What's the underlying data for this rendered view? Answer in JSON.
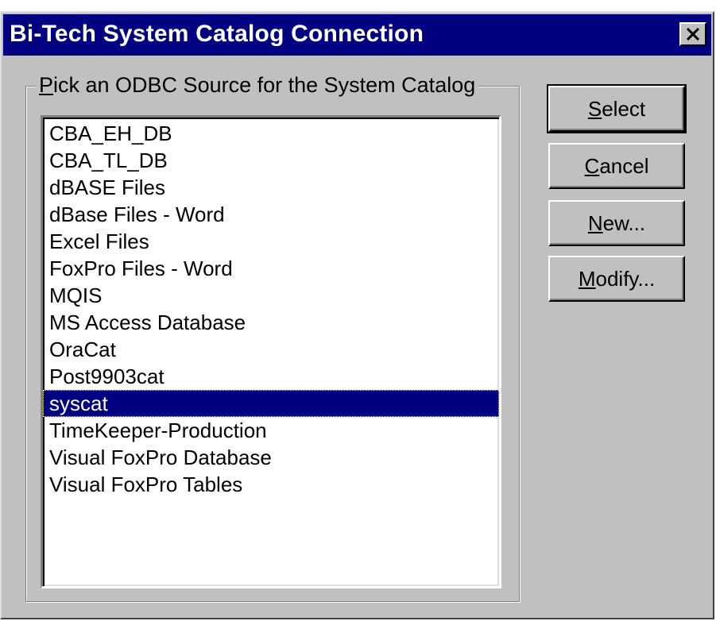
{
  "window": {
    "title": "Bi-Tech System Catalog Connection",
    "close_glyph": "✕"
  },
  "group": {
    "label_accel": "P",
    "label_rest": "ick an ODBC Source for the System Catalog"
  },
  "list": {
    "items": [
      "CBA_EH_DB",
      "CBA_TL_DB",
      "dBASE Files",
      "dBase Files - Word",
      "Excel Files",
      "FoxPro Files - Word",
      "MQIS",
      "MS Access Database",
      "OraCat",
      "Post9903cat",
      "syscat",
      "TimeKeeper-Production",
      "Visual FoxPro Database",
      "Visual FoxPro Tables"
    ],
    "selected_index": 10
  },
  "buttons": {
    "select": {
      "accel": "S",
      "rest": "elect"
    },
    "cancel": {
      "accel": "C",
      "rest": "ancel"
    },
    "new": {
      "accel": "N",
      "rest": "ew..."
    },
    "modify": {
      "accel": "M",
      "rest": "odify..."
    }
  },
  "colors": {
    "titlebar": "#000080",
    "face": "#c0c0c0",
    "selection": "#000080"
  }
}
